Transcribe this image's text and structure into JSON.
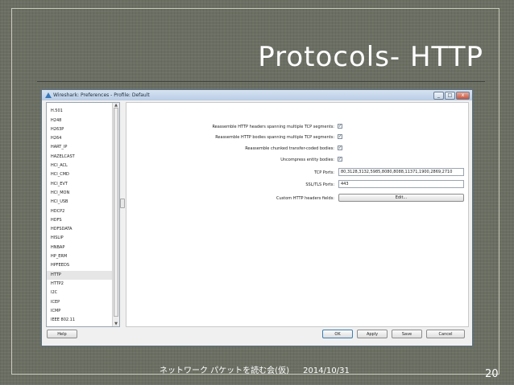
{
  "slide": {
    "title": "Protocols- HTTP",
    "footer_text": "ネットワーク パケットを読む会(仮)",
    "footer_date": "2014/10/31",
    "page_number": "20"
  },
  "window": {
    "title": "Wireshark: Preferences - Profile: Default",
    "controls": {
      "minimize": "_",
      "maximize": "□",
      "close": "x"
    }
  },
  "sidebar": {
    "items": [
      {
        "label": "H.248"
      },
      {
        "label": "H.501"
      },
      {
        "label": "H248"
      },
      {
        "label": "H263P"
      },
      {
        "label": "H264"
      },
      {
        "label": "HART_IP"
      },
      {
        "label": "HAZELCAST"
      },
      {
        "label": "HCI_ACL"
      },
      {
        "label": "HCI_CMD"
      },
      {
        "label": "HCI_EVT"
      },
      {
        "label": "HCI_MON"
      },
      {
        "label": "HCI_USB"
      },
      {
        "label": "HDCP2"
      },
      {
        "label": "HDFS"
      },
      {
        "label": "HDFSDATA"
      },
      {
        "label": "HISLIP"
      },
      {
        "label": "HNBAP"
      },
      {
        "label": "HP_ERM"
      },
      {
        "label": "HPFEEDS"
      },
      {
        "label": "HTTP",
        "selected": true
      },
      {
        "label": "HTTP2"
      },
      {
        "label": "I2C"
      },
      {
        "label": "ICEP"
      },
      {
        "label": "ICMP"
      },
      {
        "label": "IEEE 802.11"
      }
    ]
  },
  "http_prefs": {
    "reassemble_headers": {
      "label": "Reassemble HTTP headers spanning multiple TCP segments:",
      "checked": true
    },
    "reassemble_bodies": {
      "label": "Reassemble HTTP bodies spanning multiple TCP segments:",
      "checked": true
    },
    "reassemble_chunked": {
      "label": "Reassemble chunked transfer-coded bodies:",
      "checked": true
    },
    "uncompress": {
      "label": "Uncompress entity bodies:",
      "checked": true
    },
    "tcp_ports": {
      "label": "TCP Ports:",
      "value": "80,3128,3132,5985,8080,8088,11371,1900,2869,2710"
    },
    "ssl_ports": {
      "label": "SSL/TLS Ports:",
      "value": "443"
    },
    "custom_headers": {
      "label": "Custom HTTP headers fields:",
      "button": "Edit..."
    }
  },
  "footer_buttons": {
    "help": "Help",
    "ok": "OK",
    "apply": "Apply",
    "save": "Save",
    "cancel": "Cancel"
  },
  "colors": {
    "slide_background": "#6b6f63",
    "title": "#ffffff",
    "window_border": "#58708a"
  }
}
